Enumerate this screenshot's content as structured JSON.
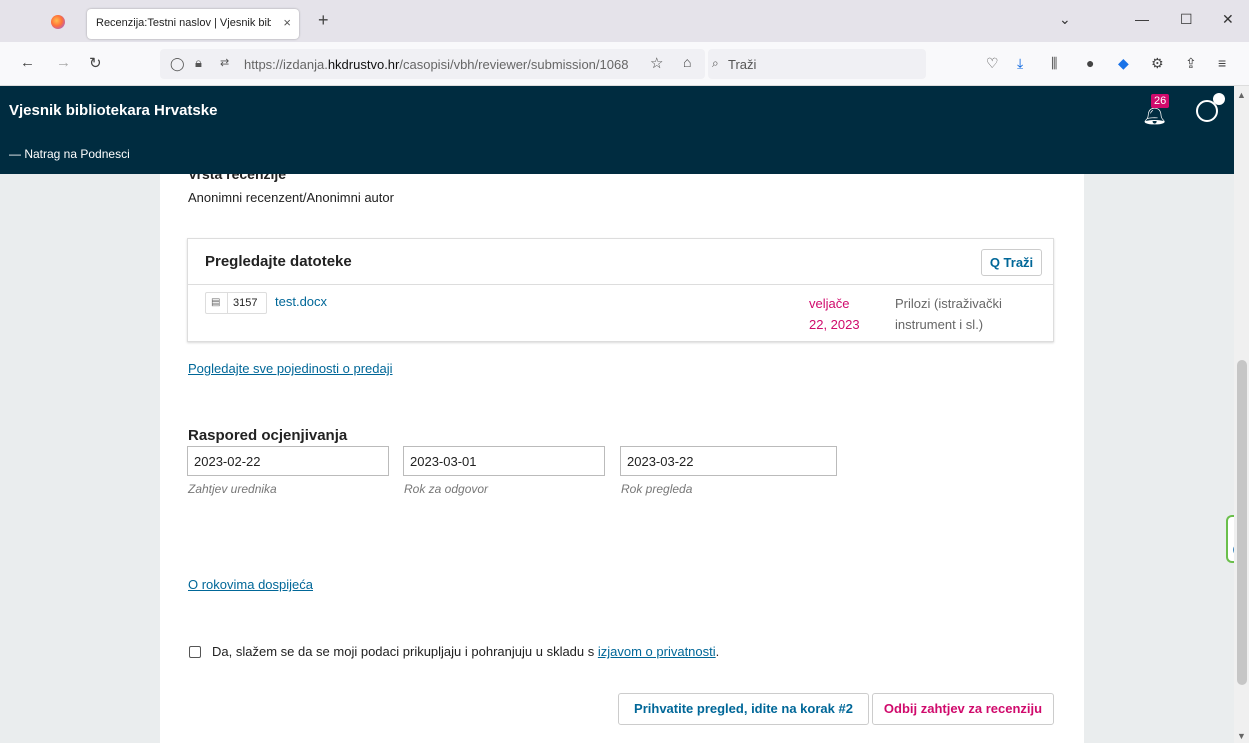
{
  "browser": {
    "tab_title": "Recenzija:Testni naslov | Vjesnik bibl",
    "tab_close": "×",
    "new_tab": "+",
    "url_prefix": "https://izdanja.",
    "url_domain": "hkdrustvo.hr",
    "url_path": "/casopisi/vbh/reviewer/submission/1068",
    "search_placeholder": "Traži"
  },
  "header": {
    "title": "Vjesnik bibliotekara Hrvatske",
    "back_link": "— Natrag na Podnesci",
    "notification_count": "26"
  },
  "review": {
    "type_heading": "Vrsta recenzije",
    "type_value": "Anonimni recenzent/Anonimni autor"
  },
  "files": {
    "title": "Pregledajte datoteke",
    "search_button": "Q Traži",
    "rows": [
      {
        "id": "3157",
        "name": "test.docx",
        "date": "veljače 22, 2023",
        "type": "Prilozi (istraživački instrument i sl.)"
      }
    ]
  },
  "details_link": "Pogledajte sve pojedinosti o predaji",
  "schedule": {
    "heading": "Raspored ocjenjivanja",
    "fields": [
      {
        "value": "2023-02-22",
        "label": "Zahtjev urednika"
      },
      {
        "value": "2023-03-01",
        "label": "Rok za odgovor"
      },
      {
        "value": "2023-03-22",
        "label": "Rok pregleda"
      }
    ]
  },
  "due_link": "O rokovima dospijeća",
  "consent": {
    "text": "Da, slažem se da se moji podaci prikupljaju i pohranjuju u skladu s ",
    "link": "izjavom o privatnosti",
    "suffix": "."
  },
  "actions": {
    "accept": "Prihvatite pregled, idite na korak #2",
    "decline": "Odbij zahtjev za recenziju"
  },
  "colors": {
    "header_bg": "#002c40",
    "link": "#006798",
    "accent": "#d00a6c"
  }
}
